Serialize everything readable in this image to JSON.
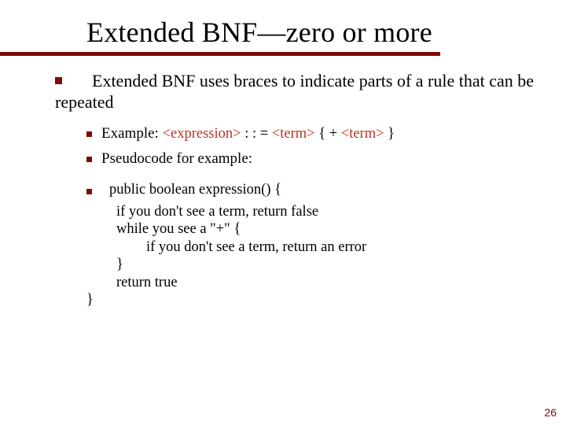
{
  "title": "Extended BNF—zero or more",
  "bullets": {
    "main": "Extended BNF uses braces to indicate parts of a rule that can be repeated",
    "sub": [
      {
        "label": "Example:  ",
        "code": {
          "expr": "<expression>",
          "assign": " : : = ",
          "term1": "<term>",
          "lbrace": " { ",
          "plus": "+ ",
          "term2": "<term>",
          "rbrace": " }"
        }
      },
      {
        "label": "Pseudocode for example:"
      }
    ]
  },
  "code": [
    "public boolean expression() {",
    "if you don't see a term, return false",
    "while you see a \"+\" {",
    "if you don't see a term, return an error",
    "}",
    "return true",
    "}"
  ],
  "page": "26"
}
